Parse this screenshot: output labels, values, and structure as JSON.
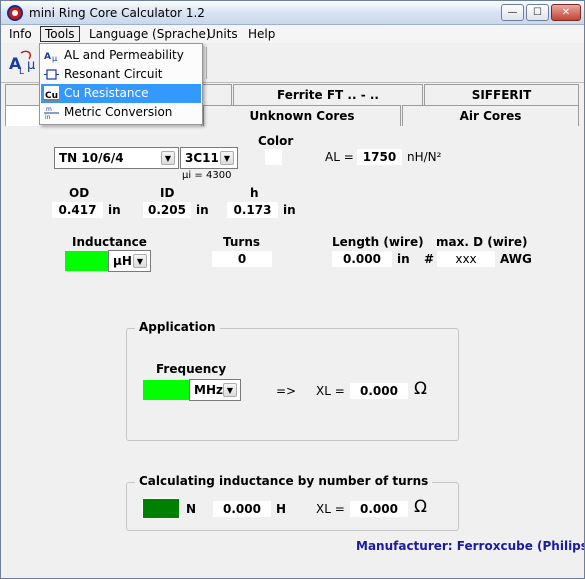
{
  "window": {
    "title": "mini Ring Core Calculator 1.2",
    "min": "—",
    "max": "☐",
    "close": "✕"
  },
  "menu": {
    "info": "Info",
    "tools": "Tools",
    "language": "Language (Sprache)",
    "units": "Units",
    "help": "Help"
  },
  "tools_menu": {
    "items": [
      {
        "label": "AL and Permeability",
        "icon": "al-mu-icon"
      },
      {
        "label": "Resonant Circuit",
        "icon": "coil-icon"
      },
      {
        "label": "Cu Resistance",
        "icon": "cu-icon"
      },
      {
        "label": "Metric Conversion",
        "icon": "metric-icon"
      }
    ],
    "highlighted_index": 2
  },
  "tabs": {
    "row1": [
      "Ferrite FT .. - ..",
      "SIFFERIT"
    ],
    "row2": [
      "Unknown Cores",
      "Air Cores"
    ]
  },
  "core": {
    "core_select": "TN 10/6/4",
    "material_select": "3C11",
    "mu_label": "µi =",
    "mu_value": "4300",
    "color_label": "Color",
    "al_label": "AL =",
    "al_value": "1750",
    "al_unit": "nH/N²"
  },
  "dims": {
    "od_label": "OD",
    "od_value": "0.417",
    "od_unit": "in",
    "id_label": "ID",
    "id_value": "0.205",
    "id_unit": "in",
    "h_label": "h",
    "h_value": "0.173",
    "h_unit": "in"
  },
  "winding": {
    "inductance_label": "Inductance",
    "inductance_unit": "µH",
    "turns_label": "Turns",
    "turns_value": "0",
    "length_label": "Length (wire)",
    "length_value": "0.000",
    "length_unit": "in",
    "hash": "#",
    "maxd_label": "max. D (wire)",
    "maxd_value": "xxx",
    "awg": "AWG"
  },
  "application": {
    "title": "Application",
    "frequency_label": "Frequency",
    "freq_unit": "MHz",
    "arrow": "=>",
    "xl_label": "XL =",
    "xl_value": "0.000",
    "ohm": "Ω"
  },
  "calc": {
    "title": "Calculating inductance by number of turns",
    "n_label": "N",
    "h_value": "0.000",
    "h_unit": "H",
    "xl_label": "XL =",
    "xl_value": "0.000",
    "ohm": "Ω"
  },
  "manufacturer": "Manufacturer: Ferroxcube (Philips)",
  "colors": {
    "active_green": "#00ff00",
    "dark_green": "#008000",
    "highlight": "#3399ff",
    "manufacturer_blue": "#1a1aa8"
  }
}
